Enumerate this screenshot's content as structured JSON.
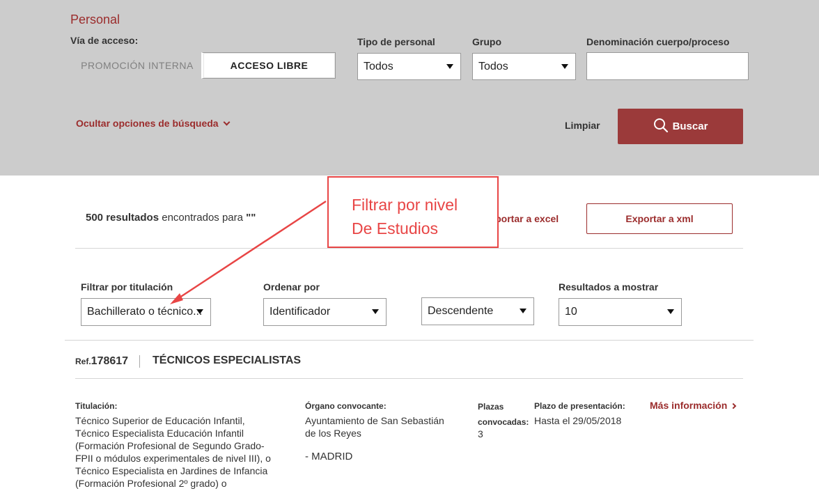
{
  "search": {
    "section_title": "Personal",
    "access_label": "Vía de acceso:",
    "access_internal": "PROMOCIÓN INTERNA",
    "access_free": "ACCESO LIBRE",
    "staff_type_label": "Tipo de personal",
    "staff_type_value": "Todos",
    "group_label": "Grupo",
    "group_value": "Todos",
    "denomination_label": "Denominación cuerpo/proceso",
    "denomination_value": "",
    "hide_options": "Ocultar opciones de búsqueda",
    "clear": "Limpiar",
    "search_button": "Buscar"
  },
  "results": {
    "count": "500 resultados",
    "found_for": "encontrados para",
    "query": "\"\"",
    "export_excel": "Exportar a excel",
    "export_xml": "Exportar a xml"
  },
  "filters": {
    "degree_label": "Filtrar por titulación",
    "degree_value": "Bachillerato o técnico...",
    "order_label": "Ordenar por",
    "order_value": "Identificador",
    "direction_value": "Descendente",
    "per_page_label": "Resultados a mostrar",
    "per_page_value": "10"
  },
  "item": {
    "ref_prefix": "Ref.",
    "ref_number": "178617",
    "title": "TÉCNICOS ESPECIALISTAS",
    "degree_label": "Titulación:",
    "degree_lines": [
      "Técnico Superior de Educación Infantil,",
      "Técnico Especialista Educación Infantil",
      "(Formación Profesional de Segundo Grado-",
      "FPII o módulos experimentales de nivel III), o",
      "Técnico Especialista en Jardines de Infancia",
      "(Formación Profesional 2º grado) o"
    ],
    "organ_label": "Órgano convocante:",
    "organ_line1": "Ayuntamiento de San Sebastián",
    "organ_line2": "de los Reyes",
    "organ_line3": "- MADRID",
    "places_label1": "Plazas",
    "places_label2": "convocadas:",
    "places_value": "3",
    "deadline_label": "Plazo de presentación:",
    "deadline_value": "Hasta el 29/05/2018",
    "more_info": "Más información"
  },
  "annotation": {
    "line1": "Filtrar por nivel",
    "line2": "De Estudios"
  },
  "colors": {
    "brand_red": "#9b3a3a",
    "annotation_red": "#e84545",
    "panel_grey": "#cccccc"
  }
}
